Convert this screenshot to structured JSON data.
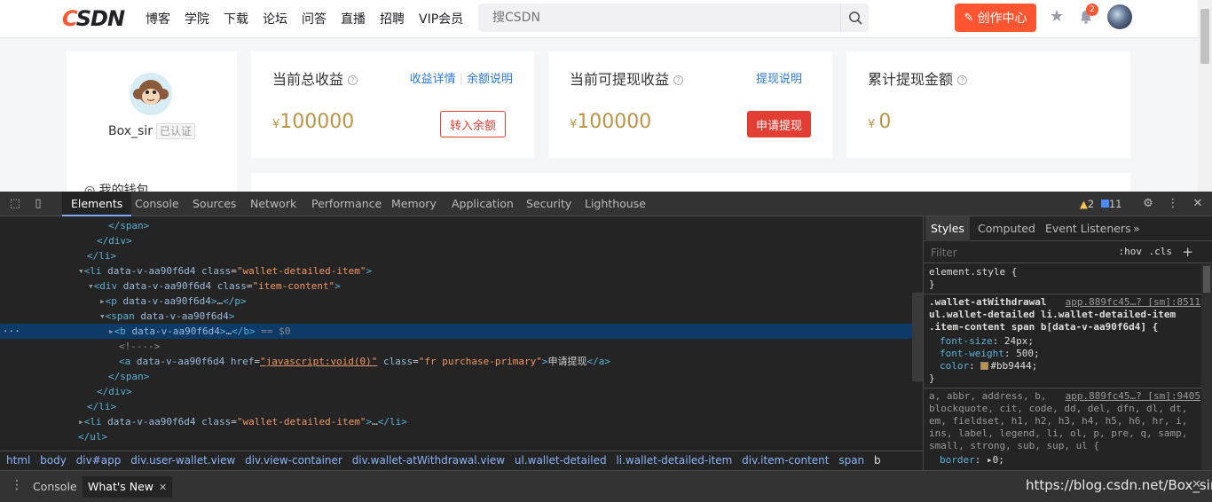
{
  "header": {
    "logo": "CSDN",
    "nav": [
      "博客",
      "学院",
      "下载",
      "论坛",
      "问答",
      "直播",
      "招聘",
      "VIP会员"
    ],
    "search_placeholder": "搜CSDN",
    "create_button": "创作中心",
    "notification_count": "2"
  },
  "profile": {
    "username": "Box_sir",
    "verified_tag": "已认证",
    "menu_wallet": "我的钱包"
  },
  "stats": [
    {
      "title": "当前总收益",
      "currency": "¥",
      "amount": "100000",
      "links": [
        "收益详情",
        "余额说明"
      ],
      "button": "转入余额"
    },
    {
      "title": "当前可提现收益",
      "currency": "¥",
      "amount": "100000",
      "links": [
        "提现说明"
      ],
      "button": "申请提现"
    },
    {
      "title": "累计提现金额",
      "currency": "¥ ",
      "amount": "0"
    }
  ],
  "devtools": {
    "tabs": [
      "Elements",
      "Console",
      "Sources",
      "Network",
      "Performance",
      "Memory",
      "Application",
      "Security",
      "Lighthouse"
    ],
    "active_tab": "Elements",
    "warnings": "2",
    "messages": "11",
    "dom_lines": {
      "l1": "</span>",
      "l2": "</div>",
      "l3": "</li>",
      "l4_tag": "li",
      "l4_attr": "data-v-aa90f6d4",
      "l4_class_name": "class",
      "l4_class_val": "\"wallet-detailed-item\"",
      "l5_tag": "div",
      "l5_class_val": "\"item-content\"",
      "l6_tag": "p",
      "l7_tag": "span",
      "l8_tag": "b",
      "l8_suffix": "== $0",
      "l9_comment": "<!---->",
      "l10_tag": "a",
      "l10_href": "\"javascript:void(0)\"",
      "l10_class_val": "\"fr purchase-primary\"",
      "l10_text": "申请提现",
      "l11": "</span>",
      "l12": "</div>",
      "l13": "</li>",
      "l14_class_val": "\"wallet-detailed-item\"",
      "l15": "</ul>"
    },
    "breadcrumbs": [
      "html",
      "body",
      "div#app",
      "div.user-wallet.view",
      "div.view-container",
      "div.wallet-atWithdrawal.view",
      "ul.wallet-detailed",
      "li.wallet-detailed-item",
      "div.item-content",
      "span",
      "b"
    ],
    "styles_tabs": [
      "Styles",
      "Computed",
      "Event Listeners"
    ],
    "filter_placeholder": "Filter",
    "filter_hov": ":hov",
    "filter_cls": ".cls",
    "rules": {
      "element_style": "element.style {",
      "element_close": "}",
      "r1_selector_a": ".wallet-atWithdrawal",
      "r1_selector_b": "ul.wallet-detailed li.wallet-detailed-item",
      "r1_selector_c": ".item-content span b[data-v-aa90f6d4] {",
      "r1_source": "app.889fc45…? [sm]:8511",
      "r1_p1_name": "font-size",
      "r1_p1_val": "24px;",
      "r1_p2_name": "font-weight",
      "r1_p2_val": "500;",
      "r1_p3_name": "color",
      "r1_p3_val": "#bb9444;",
      "r1_close": "}",
      "r2_source": "app.889fc45…? [sm]:9405",
      "r2_line1": "a, abbr, address, b,",
      "r2_line2": "blockquote, cit, code, dd, del, dfn, dl, dt,",
      "r2_line3": "em, fieldset, h1, h2, h3, h4, h5, h6, hr, i,",
      "r2_line4": "ins, label, legend, li, ol, p, pre, q, samp,",
      "r2_line5": "small, strong, sub, sup, ul {",
      "r2_p1_name": "border",
      "r2_p1_val": "0;"
    },
    "drawer_tabs": [
      "Console",
      "What's New"
    ],
    "watermark": "https://blog.csdn.net/Box_sir"
  }
}
